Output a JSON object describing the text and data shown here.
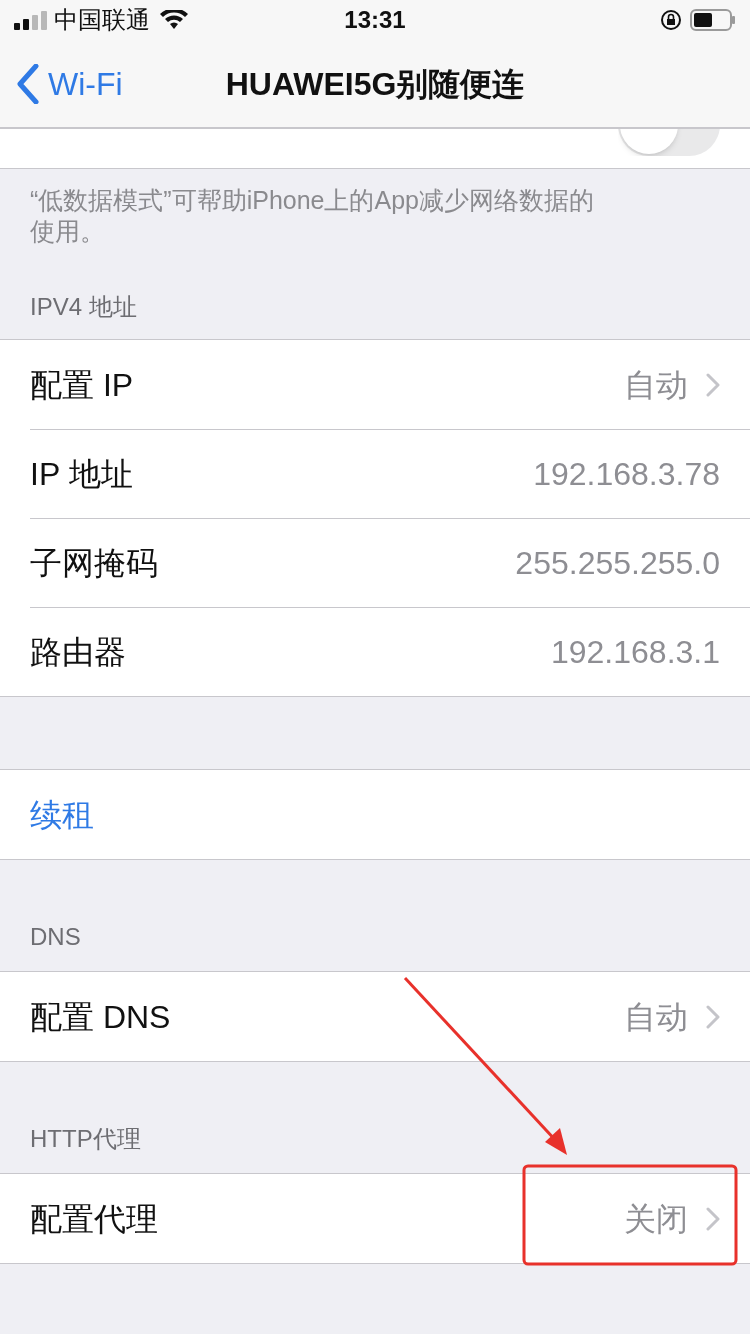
{
  "status_bar": {
    "carrier": "中国联通",
    "time": "13:31"
  },
  "nav": {
    "back": "Wi-Fi",
    "title": "HUAWEI5G别随便连"
  },
  "sections": [
    {
      "rows": [
        {
          "kind": "toggle",
          "on": false
        }
      ],
      "footer": "“低数据模式”可帮助iPhone上的App减少网络数据的使用。"
    },
    {
      "header": "IPV4 地址",
      "rows": [
        {
          "kind": "link",
          "label": "配置 IP",
          "value": "自动"
        },
        {
          "kind": "info",
          "label": "IP 地址",
          "value": "192.168.3.78"
        },
        {
          "kind": "info",
          "label": "子网掩码",
          "value": "255.255.255.0"
        },
        {
          "kind": "info",
          "label": "路由器",
          "value": "192.168.3.1"
        }
      ]
    },
    {
      "rows": [
        {
          "kind": "action",
          "label": "续租"
        }
      ]
    },
    {
      "header": "DNS",
      "rows": [
        {
          "kind": "link",
          "label": "配置 DNS",
          "value": "自动"
        }
      ]
    },
    {
      "header": "HTTP代理",
      "rows": [
        {
          "kind": "link",
          "label": "配置代理",
          "value": "关闭"
        }
      ]
    }
  ]
}
